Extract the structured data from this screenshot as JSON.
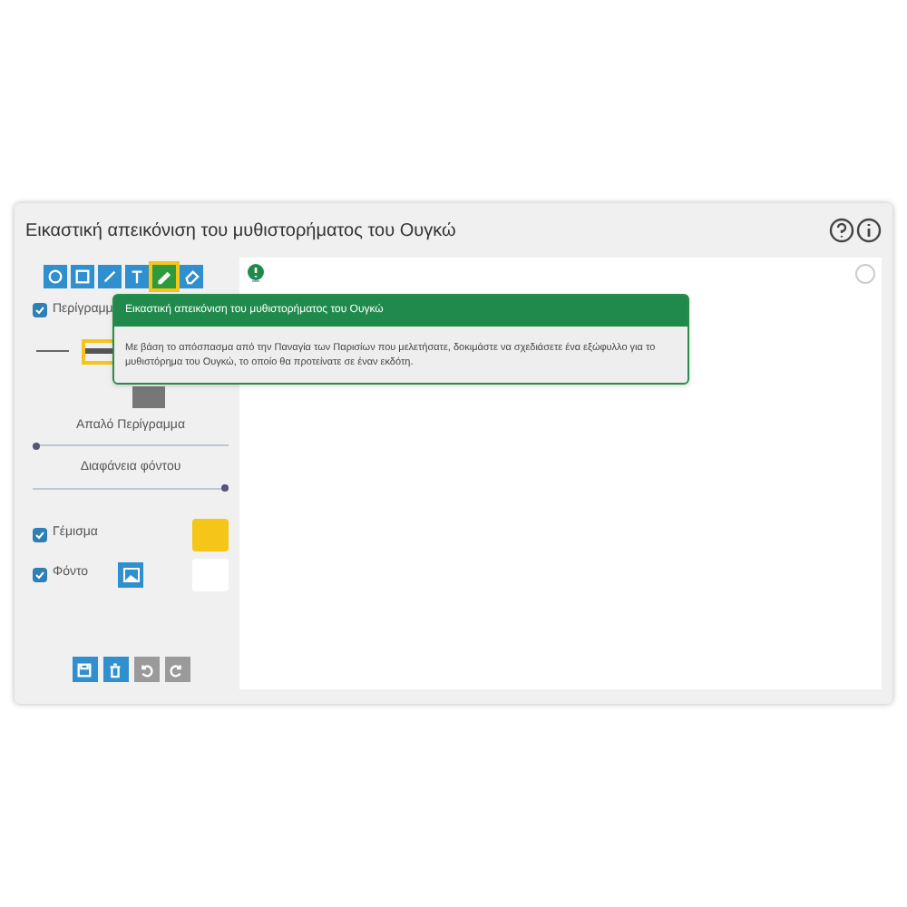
{
  "window": {
    "title": "Εικαστική απεικόνιση του μυθιστορήματος του Ουγκώ"
  },
  "tools": [
    {
      "kind": "circle",
      "selected": false
    },
    {
      "kind": "square",
      "selected": false
    },
    {
      "kind": "line",
      "selected": false
    },
    {
      "kind": "text",
      "selected": false
    },
    {
      "kind": "pencil",
      "selected": true
    },
    {
      "kind": "eraser",
      "selected": false
    }
  ],
  "outline": {
    "label": "Περίγραμμ",
    "checked": true
  },
  "line_styles": [
    {
      "kind": "thin",
      "selected": false
    },
    {
      "kind": "thick",
      "selected": true
    }
  ],
  "sliders": [
    {
      "label": "Απαλό Περίγραμμα",
      "level": 0
    },
    {
      "label": "Διαφάνεια φόντου",
      "level": 1
    }
  ],
  "fill": {
    "label": "Γέμισμα",
    "checked": true,
    "color": "#f5c518"
  },
  "background": {
    "label": "Φόντο",
    "checked": true,
    "color": "#ffffff"
  },
  "actions": [
    {
      "kind": "save",
      "disabled": false
    },
    {
      "kind": "delete",
      "disabled": false
    },
    {
      "kind": "undo",
      "disabled": true
    },
    {
      "kind": "redo",
      "disabled": true
    }
  ],
  "tooltip": {
    "title": "Εικαστική απεικόνιση του μυθιστορήματος του Ουγκώ",
    "text": "Με βάση το απόσπασμα από την Παναγία των Παρισίων που μελετήσατε, δοκιμάστε να σχεδιάσετε ένα εξώφυλλο για το μυθιστόρημα του Ουγκώ, το οποίο θα προτείνατε σε έναν εκδότη."
  }
}
